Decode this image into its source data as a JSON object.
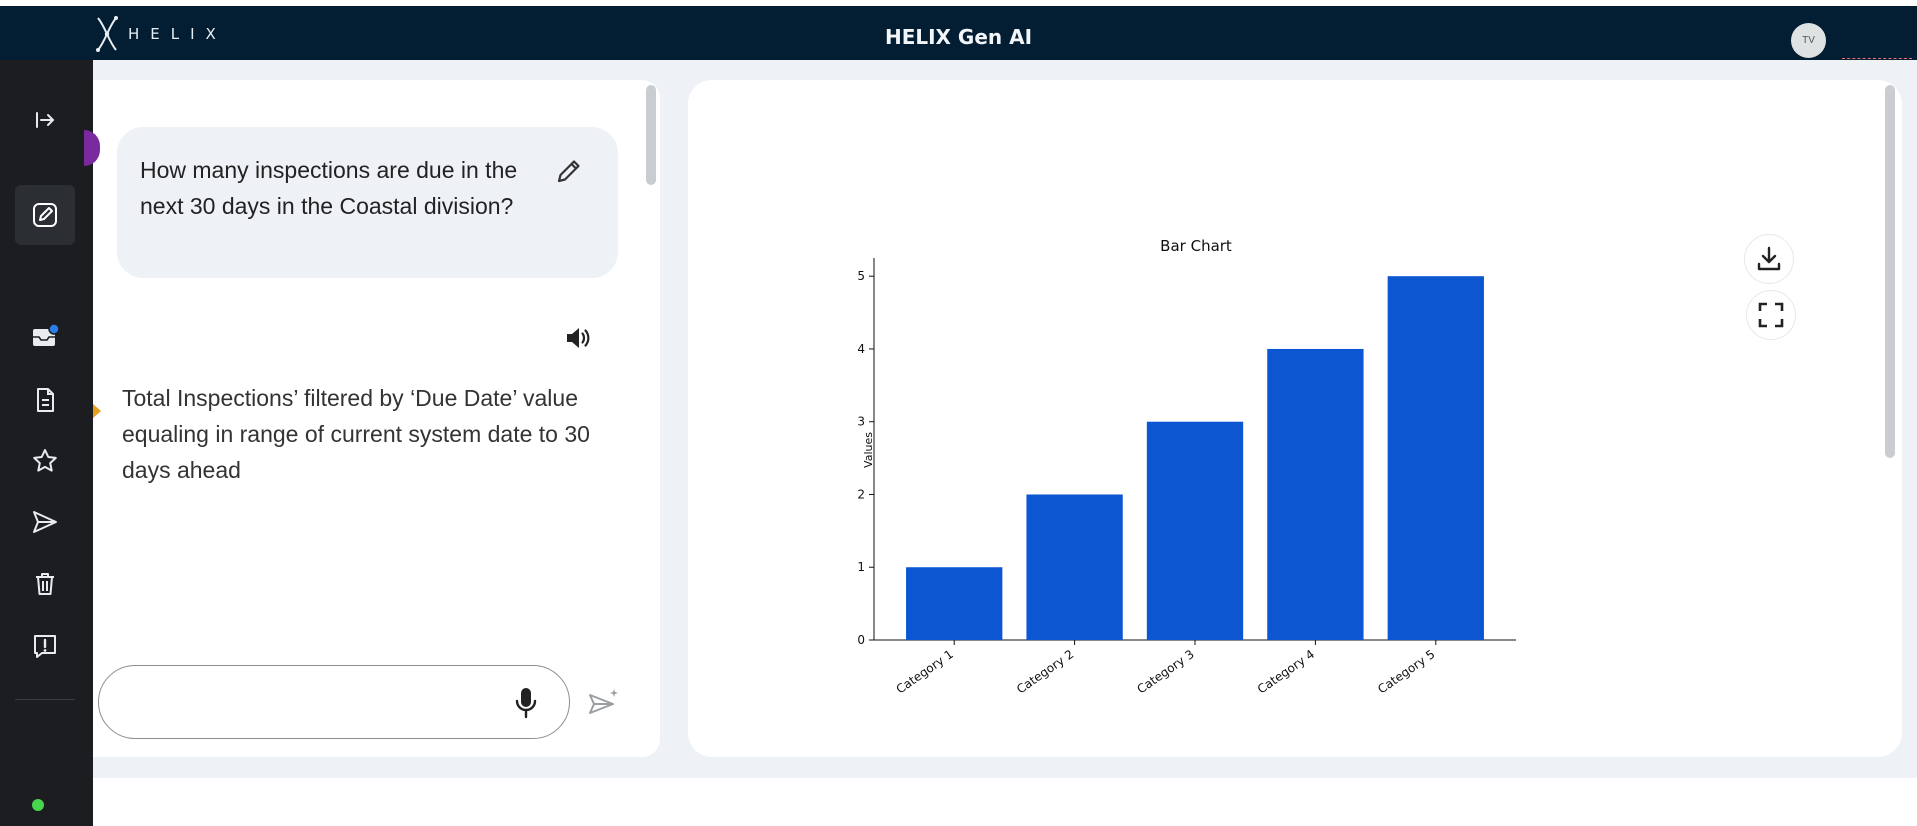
{
  "header": {
    "logo_text": "HELIX",
    "title": "HELIX Gen AI",
    "avatar_initials": "TV"
  },
  "sidebar": {
    "items": [
      {
        "icon": "expand-sidebar-icon"
      },
      {
        "icon": "new-chat-icon",
        "active": true
      },
      {
        "icon": "inbox-icon",
        "badge": true
      },
      {
        "icon": "document-icon"
      },
      {
        "icon": "star-icon"
      },
      {
        "icon": "send-icon"
      },
      {
        "icon": "trash-icon"
      },
      {
        "icon": "alert-icon"
      }
    ],
    "status_color": "#48d44c"
  },
  "chat": {
    "question": "How many inspections are due in the next 30 days in the Coastal division?",
    "answer": "Total Inspections’ filtered by ‘Due Date’ value equaling in range of current system date to 30 days ahead",
    "input": {
      "value": "",
      "placeholder": ""
    }
  },
  "colors": {
    "topbar": "#031d32",
    "sidebar": "#1b1d21",
    "bar": "#0d56d1",
    "accent_purple": "#7a2a9e",
    "accent_orange": "#e5a11a"
  },
  "chart_data": {
    "type": "bar",
    "title": "Bar Chart",
    "xlabel": "",
    "ylabel": "Values",
    "categories": [
      "Category 1",
      "Category 2",
      "Category 3",
      "Category 4",
      "Category 5"
    ],
    "values": [
      1,
      2,
      3,
      4,
      5
    ],
    "ylim": [
      0,
      5.25
    ],
    "yticks": [
      0,
      1,
      2,
      3,
      4,
      5
    ],
    "grid": false,
    "color": "#0d56d1"
  }
}
